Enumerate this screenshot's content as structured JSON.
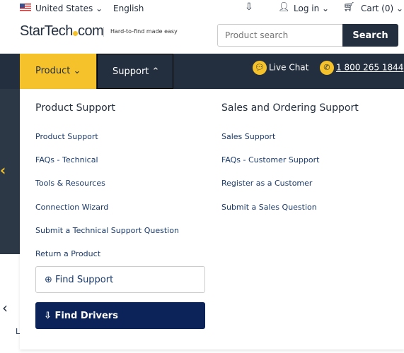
{
  "topbar": {
    "country": "United States",
    "language": "English",
    "login": "Log in",
    "cart": "Cart (0)"
  },
  "header": {
    "logo": "StarTech.com",
    "tagline": "Hard-to-find made easy",
    "search_placeholder": "Product search",
    "search_button": "Search"
  },
  "nav": {
    "product": "Product",
    "support": "Support",
    "live_chat": "Live Chat",
    "phone": "1 800 265 1844"
  },
  "menu": {
    "col1": {
      "title": "Product Support",
      "links": [
        "Product Support",
        "FAQs - Technical",
        "Tools & Resources",
        "Connection Wizard",
        "Submit a Technical Support Question",
        "Return a Product"
      ]
    },
    "col2": {
      "title": "Sales and Ordering Support",
      "links": [
        "Sales Support",
        "FAQs - Customer Support",
        "Register as a Customer",
        "Submit a Sales Question"
      ]
    },
    "find_support": "Find Support",
    "find_drivers": "Find Drivers"
  },
  "background": {
    "partial_text": "L"
  },
  "colors": {
    "accent": "#f5c22b",
    "navy": "#232f3e",
    "drivers": "#0b2358"
  }
}
